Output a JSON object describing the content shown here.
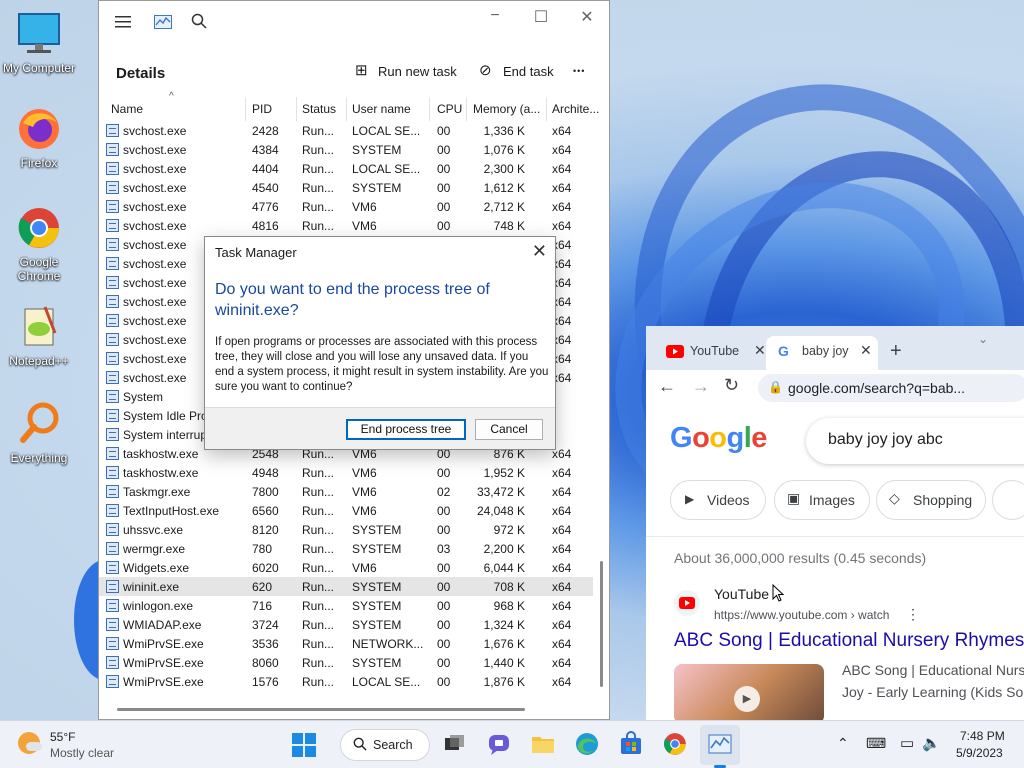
{
  "desktop": {
    "icons": [
      {
        "label": "My Computer"
      },
      {
        "label": "Firefox"
      },
      {
        "label": "Google Chrome"
      },
      {
        "label": "Notepad++"
      },
      {
        "label": "Everything"
      }
    ]
  },
  "task_manager": {
    "section_title": "Details",
    "run_new_task_label": "Run new task",
    "end_task_label": "End task",
    "more_label": "•••",
    "columns": [
      "Name",
      "PID",
      "Status",
      "User name",
      "CPU",
      "Memory (a...",
      "Archite..."
    ],
    "rows": [
      {
        "name": "svchost.exe",
        "pid": "2428",
        "status": "Run...",
        "user": "LOCAL SE...",
        "cpu": "00",
        "mem": "1,336 K",
        "arch": "x64"
      },
      {
        "name": "svchost.exe",
        "pid": "4384",
        "status": "Run...",
        "user": "SYSTEM",
        "cpu": "00",
        "mem": "1,076 K",
        "arch": "x64"
      },
      {
        "name": "svchost.exe",
        "pid": "4404",
        "status": "Run...",
        "user": "LOCAL SE...",
        "cpu": "00",
        "mem": "2,300 K",
        "arch": "x64"
      },
      {
        "name": "svchost.exe",
        "pid": "4540",
        "status": "Run...",
        "user": "SYSTEM",
        "cpu": "00",
        "mem": "1,612 K",
        "arch": "x64"
      },
      {
        "name": "svchost.exe",
        "pid": "4776",
        "status": "Run...",
        "user": "VM6",
        "cpu": "00",
        "mem": "2,712 K",
        "arch": "x64"
      },
      {
        "name": "svchost.exe",
        "pid": "4816",
        "status": "Run...",
        "user": "VM6",
        "cpu": "00",
        "mem": "748 K",
        "arch": "x64"
      },
      {
        "name": "svchost.exe",
        "pid": "",
        "status": "",
        "user": "",
        "cpu": "",
        "mem": "",
        "arch": "x64"
      },
      {
        "name": "svchost.exe",
        "pid": "",
        "status": "",
        "user": "",
        "cpu": "",
        "mem": "",
        "arch": "x64"
      },
      {
        "name": "svchost.exe",
        "pid": "",
        "status": "",
        "user": "",
        "cpu": "",
        "mem": "",
        "arch": "x64"
      },
      {
        "name": "svchost.exe",
        "pid": "",
        "status": "",
        "user": "",
        "cpu": "",
        "mem": "",
        "arch": "x64"
      },
      {
        "name": "svchost.exe",
        "pid": "",
        "status": "",
        "user": "",
        "cpu": "",
        "mem": "",
        "arch": "x64"
      },
      {
        "name": "svchost.exe",
        "pid": "",
        "status": "",
        "user": "",
        "cpu": "",
        "mem": "",
        "arch": "x64"
      },
      {
        "name": "svchost.exe",
        "pid": "",
        "status": "",
        "user": "",
        "cpu": "",
        "mem": "",
        "arch": "x64"
      },
      {
        "name": "svchost.exe",
        "pid": "",
        "status": "",
        "user": "",
        "cpu": "",
        "mem": "",
        "arch": "x64"
      },
      {
        "name": "System",
        "pid": "",
        "status": "",
        "user": "",
        "cpu": "",
        "mem": "",
        "arch": ""
      },
      {
        "name": "System Idle Pro",
        "pid": "",
        "status": "",
        "user": "",
        "cpu": "",
        "mem": "",
        "arch": ""
      },
      {
        "name": "System interrup",
        "pid": "",
        "status": "",
        "user": "",
        "cpu": "",
        "mem": "",
        "arch": ""
      },
      {
        "name": "taskhostw.exe",
        "pid": "2548",
        "status": "Run...",
        "user": "VM6",
        "cpu": "00",
        "mem": "876 K",
        "arch": "x64"
      },
      {
        "name": "taskhostw.exe",
        "pid": "4948",
        "status": "Run...",
        "user": "VM6",
        "cpu": "00",
        "mem": "1,952 K",
        "arch": "x64"
      },
      {
        "name": "Taskmgr.exe",
        "pid": "7800",
        "status": "Run...",
        "user": "VM6",
        "cpu": "02",
        "mem": "33,472 K",
        "arch": "x64"
      },
      {
        "name": "TextInputHost.exe",
        "pid": "6560",
        "status": "Run...",
        "user": "VM6",
        "cpu": "00",
        "mem": "24,048 K",
        "arch": "x64"
      },
      {
        "name": "uhssvc.exe",
        "pid": "8120",
        "status": "Run...",
        "user": "SYSTEM",
        "cpu": "00",
        "mem": "972 K",
        "arch": "x64"
      },
      {
        "name": "wermgr.exe",
        "pid": "780",
        "status": "Run...",
        "user": "SYSTEM",
        "cpu": "03",
        "mem": "2,200 K",
        "arch": "x64"
      },
      {
        "name": "Widgets.exe",
        "pid": "6020",
        "status": "Run...",
        "user": "VM6",
        "cpu": "00",
        "mem": "6,044 K",
        "arch": "x64"
      },
      {
        "name": "wininit.exe",
        "pid": "620",
        "status": "Run...",
        "user": "SYSTEM",
        "cpu": "00",
        "mem": "708 K",
        "arch": "x64"
      },
      {
        "name": "winlogon.exe",
        "pid": "716",
        "status": "Run...",
        "user": "SYSTEM",
        "cpu": "00",
        "mem": "968 K",
        "arch": "x64"
      },
      {
        "name": "WMIADAP.exe",
        "pid": "3724",
        "status": "Run...",
        "user": "SYSTEM",
        "cpu": "00",
        "mem": "1,324 K",
        "arch": "x64"
      },
      {
        "name": "WmiPrvSE.exe",
        "pid": "3536",
        "status": "Run...",
        "user": "NETWORK...",
        "cpu": "00",
        "mem": "1,676 K",
        "arch": "x64"
      },
      {
        "name": "WmiPrvSE.exe",
        "pid": "8060",
        "status": "Run...",
        "user": "SYSTEM",
        "cpu": "00",
        "mem": "1,440 K",
        "arch": "x64"
      },
      {
        "name": "WmiPrvSE.exe",
        "pid": "1576",
        "status": "Run...",
        "user": "LOCAL SE...",
        "cpu": "00",
        "mem": "1,876 K",
        "arch": "x64"
      }
    ]
  },
  "dialog": {
    "title": "Task Manager",
    "question": "Do you want to end the process tree of wininit.exe?",
    "body": "If open programs or processes are associated with this process tree, they will close and you will lose any unsaved data. If you end a system process, it might result in system instability. Are you sure you want to continue?",
    "primary_label": "End process tree",
    "cancel_label": "Cancel"
  },
  "browser": {
    "tabs": [
      {
        "label": "YouTube"
      },
      {
        "label": "baby joy"
      }
    ],
    "address": "google.com/search?q=bab...",
    "search_query": "baby joy joy abc",
    "logo_letters": [
      "G",
      "o",
      "o",
      "g",
      "l",
      "e"
    ],
    "chips": [
      "Videos",
      "Images",
      "Shopping"
    ],
    "result_count": "About 36,000,000 results (0.45 seconds)",
    "result_source": "YouTube",
    "result_url": "https://www.youtube.com › watch",
    "result_title": "ABC Song | Educational Nursery Rhymes",
    "snippet_line1": "ABC Song | Educational Nurse",
    "snippet_line2": "Joy - Early Learning (Kids Son"
  },
  "taskbar": {
    "weather_temp": "55°F",
    "weather_desc": "Mostly clear",
    "search_label": "Search",
    "time": "7:48 PM",
    "date": "5/9/2023"
  },
  "colors": {
    "dialog_question": "#1a47a3",
    "result_link": "#1a0dab",
    "selected_row": "#e5e5e5",
    "taskbar_bg": "#eef2f8"
  }
}
